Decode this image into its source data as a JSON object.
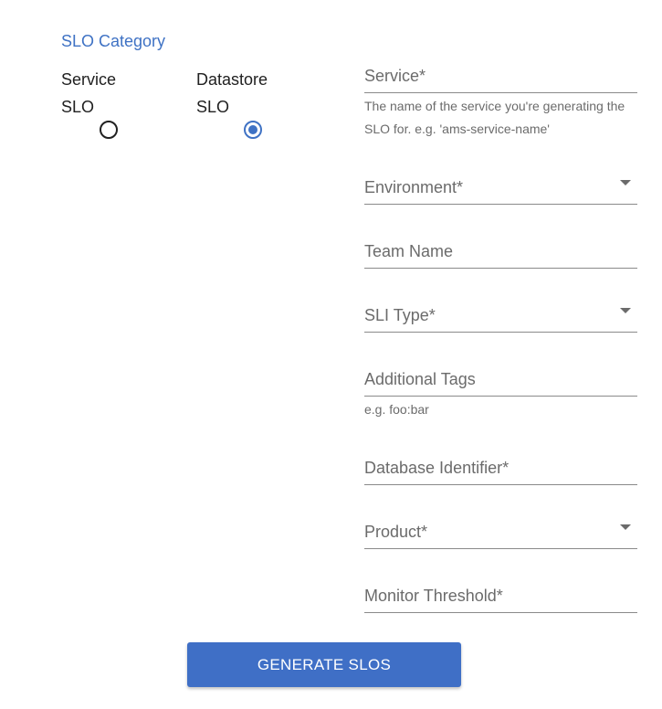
{
  "slo_category": {
    "legend": "SLO Category",
    "options": [
      {
        "label": "Service SLO",
        "checked": false
      },
      {
        "label": "Datastore SLO",
        "checked": true
      }
    ]
  },
  "fields": {
    "service": {
      "label": "Service*",
      "helper": "The name of the service you're generating the SLO for. e.g. 'ams-service-name'",
      "type": "text"
    },
    "environment": {
      "label": "Environment*",
      "type": "select"
    },
    "team_name": {
      "label": "Team Name",
      "type": "text"
    },
    "sli_type": {
      "label": "SLI Type*",
      "type": "select"
    },
    "additional_tags": {
      "label": "Additional Tags",
      "helper": "e.g. foo:bar",
      "type": "text"
    },
    "database_identifier": {
      "label": "Database Identifier*",
      "type": "text"
    },
    "product": {
      "label": "Product*",
      "type": "select"
    },
    "monitor_threshold": {
      "label": "Monitor Threshold*",
      "type": "text"
    }
  },
  "actions": {
    "generate_label": "GENERATE SLOS"
  },
  "colors": {
    "accent": "#3f72c4",
    "button_bg": "#3f6fc6",
    "label_gray": "#6b6b6b",
    "underline": "#8a8a8a"
  },
  "icons": {
    "dropdown": "caret-down-icon",
    "radio_unchecked": "radio-unchecked-icon",
    "radio_checked": "radio-checked-icon"
  }
}
